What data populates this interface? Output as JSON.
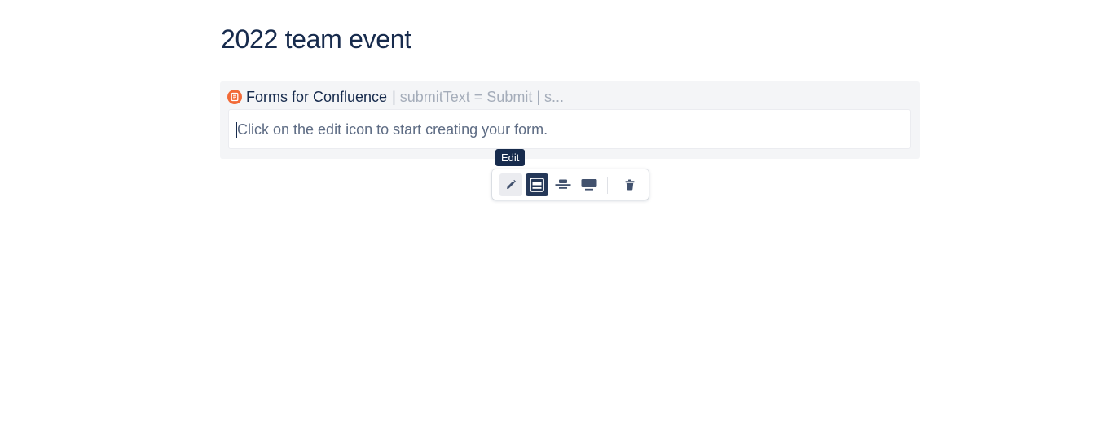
{
  "page": {
    "title": "2022 team event"
  },
  "macro": {
    "name": "Forms for Confluence",
    "params": "| submitText = Submit | s...",
    "placeholder": "Click on the edit icon to start creating your form.",
    "logo_icon": "forms-logo-icon",
    "logo_color": "#f26a37"
  },
  "tooltip": {
    "text": "Edit"
  },
  "toolbar": {
    "buttons": [
      {
        "name": "edit",
        "icon": "pencil-icon",
        "active": false
      },
      {
        "name": "layout-full-width",
        "icon": "full-width-icon",
        "active": true
      },
      {
        "name": "layout-center",
        "icon": "center-icon",
        "active": false
      },
      {
        "name": "layout-wide",
        "icon": "wide-icon",
        "active": false
      },
      {
        "name": "delete",
        "icon": "trash-icon",
        "active": false
      }
    ]
  },
  "colors": {
    "text_primary": "#172b4d",
    "text_subtle": "#5e6c84",
    "params": "#a5adba",
    "macro_bg": "#f4f5f7",
    "selected_btn": "#253858"
  }
}
